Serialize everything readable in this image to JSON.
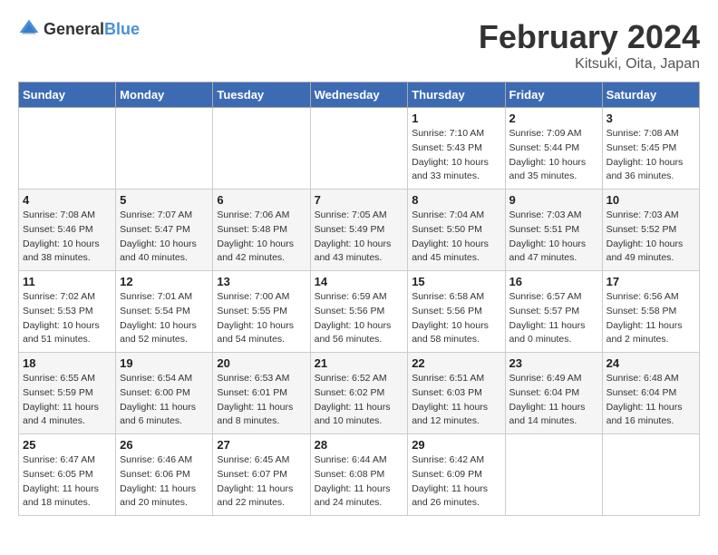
{
  "logo": {
    "text_general": "General",
    "text_blue": "Blue"
  },
  "header": {
    "month": "February 2024",
    "location": "Kitsuki, Oita, Japan"
  },
  "weekdays": [
    "Sunday",
    "Monday",
    "Tuesday",
    "Wednesday",
    "Thursday",
    "Friday",
    "Saturday"
  ],
  "weeks": [
    [
      {
        "day": "",
        "info": ""
      },
      {
        "day": "",
        "info": ""
      },
      {
        "day": "",
        "info": ""
      },
      {
        "day": "",
        "info": ""
      },
      {
        "day": "1",
        "info": "Sunrise: 7:10 AM\nSunset: 5:43 PM\nDaylight: 10 hours\nand 33 minutes."
      },
      {
        "day": "2",
        "info": "Sunrise: 7:09 AM\nSunset: 5:44 PM\nDaylight: 10 hours\nand 35 minutes."
      },
      {
        "day": "3",
        "info": "Sunrise: 7:08 AM\nSunset: 5:45 PM\nDaylight: 10 hours\nand 36 minutes."
      }
    ],
    [
      {
        "day": "4",
        "info": "Sunrise: 7:08 AM\nSunset: 5:46 PM\nDaylight: 10 hours\nand 38 minutes."
      },
      {
        "day": "5",
        "info": "Sunrise: 7:07 AM\nSunset: 5:47 PM\nDaylight: 10 hours\nand 40 minutes."
      },
      {
        "day": "6",
        "info": "Sunrise: 7:06 AM\nSunset: 5:48 PM\nDaylight: 10 hours\nand 42 minutes."
      },
      {
        "day": "7",
        "info": "Sunrise: 7:05 AM\nSunset: 5:49 PM\nDaylight: 10 hours\nand 43 minutes."
      },
      {
        "day": "8",
        "info": "Sunrise: 7:04 AM\nSunset: 5:50 PM\nDaylight: 10 hours\nand 45 minutes."
      },
      {
        "day": "9",
        "info": "Sunrise: 7:03 AM\nSunset: 5:51 PM\nDaylight: 10 hours\nand 47 minutes."
      },
      {
        "day": "10",
        "info": "Sunrise: 7:03 AM\nSunset: 5:52 PM\nDaylight: 10 hours\nand 49 minutes."
      }
    ],
    [
      {
        "day": "11",
        "info": "Sunrise: 7:02 AM\nSunset: 5:53 PM\nDaylight: 10 hours\nand 51 minutes."
      },
      {
        "day": "12",
        "info": "Sunrise: 7:01 AM\nSunset: 5:54 PM\nDaylight: 10 hours\nand 52 minutes."
      },
      {
        "day": "13",
        "info": "Sunrise: 7:00 AM\nSunset: 5:55 PM\nDaylight: 10 hours\nand 54 minutes."
      },
      {
        "day": "14",
        "info": "Sunrise: 6:59 AM\nSunset: 5:56 PM\nDaylight: 10 hours\nand 56 minutes."
      },
      {
        "day": "15",
        "info": "Sunrise: 6:58 AM\nSunset: 5:56 PM\nDaylight: 10 hours\nand 58 minutes."
      },
      {
        "day": "16",
        "info": "Sunrise: 6:57 AM\nSunset: 5:57 PM\nDaylight: 11 hours\nand 0 minutes."
      },
      {
        "day": "17",
        "info": "Sunrise: 6:56 AM\nSunset: 5:58 PM\nDaylight: 11 hours\nand 2 minutes."
      }
    ],
    [
      {
        "day": "18",
        "info": "Sunrise: 6:55 AM\nSunset: 5:59 PM\nDaylight: 11 hours\nand 4 minutes."
      },
      {
        "day": "19",
        "info": "Sunrise: 6:54 AM\nSunset: 6:00 PM\nDaylight: 11 hours\nand 6 minutes."
      },
      {
        "day": "20",
        "info": "Sunrise: 6:53 AM\nSunset: 6:01 PM\nDaylight: 11 hours\nand 8 minutes."
      },
      {
        "day": "21",
        "info": "Sunrise: 6:52 AM\nSunset: 6:02 PM\nDaylight: 11 hours\nand 10 minutes."
      },
      {
        "day": "22",
        "info": "Sunrise: 6:51 AM\nSunset: 6:03 PM\nDaylight: 11 hours\nand 12 minutes."
      },
      {
        "day": "23",
        "info": "Sunrise: 6:49 AM\nSunset: 6:04 PM\nDaylight: 11 hours\nand 14 minutes."
      },
      {
        "day": "24",
        "info": "Sunrise: 6:48 AM\nSunset: 6:04 PM\nDaylight: 11 hours\nand 16 minutes."
      }
    ],
    [
      {
        "day": "25",
        "info": "Sunrise: 6:47 AM\nSunset: 6:05 PM\nDaylight: 11 hours\nand 18 minutes."
      },
      {
        "day": "26",
        "info": "Sunrise: 6:46 AM\nSunset: 6:06 PM\nDaylight: 11 hours\nand 20 minutes."
      },
      {
        "day": "27",
        "info": "Sunrise: 6:45 AM\nSunset: 6:07 PM\nDaylight: 11 hours\nand 22 minutes."
      },
      {
        "day": "28",
        "info": "Sunrise: 6:44 AM\nSunset: 6:08 PM\nDaylight: 11 hours\nand 24 minutes."
      },
      {
        "day": "29",
        "info": "Sunrise: 6:42 AM\nSunset: 6:09 PM\nDaylight: 11 hours\nand 26 minutes."
      },
      {
        "day": "",
        "info": ""
      },
      {
        "day": "",
        "info": ""
      }
    ]
  ]
}
